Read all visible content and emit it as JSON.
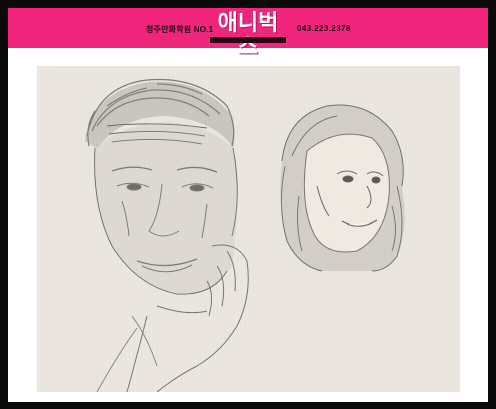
{
  "header": {
    "tagline": "청주만화학원 NO.1",
    "logo_text": "애니벅스",
    "phone": "043.223.2378"
  },
  "colors": {
    "banner": "#f0267c",
    "background": "#0a0a0a",
    "paper": "#ebe6df"
  }
}
